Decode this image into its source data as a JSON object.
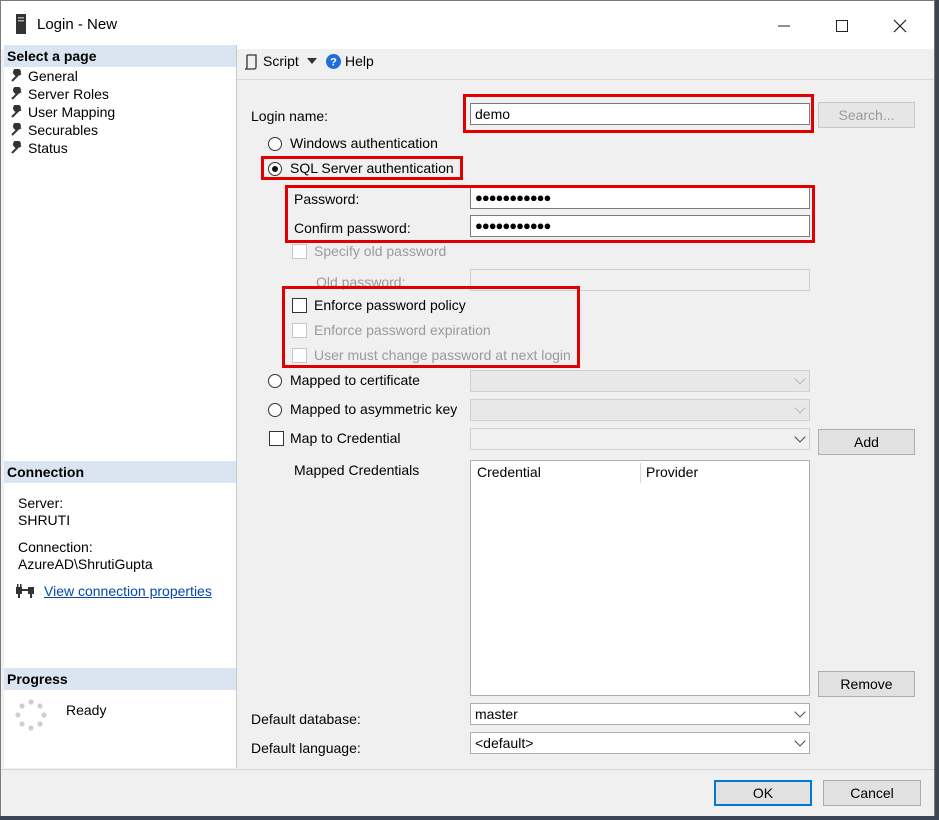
{
  "window": {
    "title": "Login - New"
  },
  "sidebar": {
    "select_page_heading": "Select a page",
    "items": [
      {
        "label": "General"
      },
      {
        "label": "Server Roles"
      },
      {
        "label": "User Mapping"
      },
      {
        "label": "Securables"
      },
      {
        "label": "Status"
      }
    ],
    "connection_heading": "Connection",
    "server_label": "Server:",
    "server_value": "SHRUTI",
    "connection_label": "Connection:",
    "connection_value": "AzureAD\\ShrutiGupta",
    "view_props_link": "View connection properties",
    "progress_heading": "Progress",
    "progress_status": "Ready"
  },
  "toolbar": {
    "script_label": "Script",
    "help_label": "Help"
  },
  "form": {
    "login_name_label": "Login name:",
    "login_name_value": "demo",
    "search_button": "Search...",
    "windows_auth_label": "Windows authentication",
    "sql_auth_label": "SQL Server authentication",
    "password_label": "Password:",
    "password_value": "●●●●●●●●●●●",
    "confirm_password_label": "Confirm password:",
    "confirm_password_value": "●●●●●●●●●●●",
    "specify_old_password_label": "Specify old password",
    "old_password_label": "Old password:",
    "enforce_policy_label": "Enforce password policy",
    "enforce_expiration_label": "Enforce password expiration",
    "must_change_label": "User must change password at next login",
    "mapped_cert_label": "Mapped to certificate",
    "mapped_asym_label": "Mapped to asymmetric key",
    "map_credential_label": "Map to Credential",
    "add_button": "Add",
    "mapped_credentials_label": "Mapped Credentials",
    "credentials_columns": [
      "Credential",
      "Provider"
    ],
    "remove_button": "Remove",
    "default_database_label": "Default database:",
    "default_database_value": "master",
    "default_language_label": "Default language:",
    "default_language_value": "<default>"
  },
  "footer": {
    "ok_button": "OK",
    "cancel_button": "Cancel"
  },
  "colors": {
    "highlight": "#e00000",
    "section_header": "#dbe5f1",
    "link": "#0645ad"
  }
}
